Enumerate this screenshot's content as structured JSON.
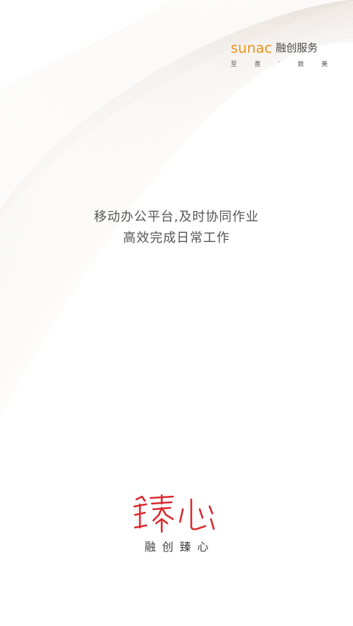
{
  "brand": {
    "name_en": "sunac",
    "name_cn": "融创服务",
    "tagline": [
      "至",
      "善",
      "·",
      "致",
      "美"
    ],
    "color": "#e8961e"
  },
  "slogan": {
    "line1": "移动办公平台,及时协同作业",
    "line2": "高效完成日常工作"
  },
  "app": {
    "logo_text": "臻心",
    "logo_color": "#d9292e",
    "subtitle": "融创臻心"
  },
  "background": {
    "pattern": "guilloche-lines",
    "line_color": "#c9b8a8"
  }
}
